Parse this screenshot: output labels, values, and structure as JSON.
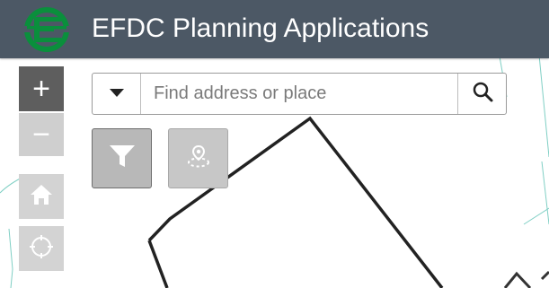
{
  "header": {
    "title": "EFDC Planning Applications",
    "logo_icon": "efdc-logo-icon",
    "background_color": "#4c5865",
    "logo_color": "#0a8f3c"
  },
  "map_controls": {
    "zoom_in_label": "+",
    "zoom_out_label": "−",
    "home_icon": "home-icon",
    "locate_icon": "locate-icon"
  },
  "search": {
    "placeholder": "Find address or place",
    "value": "",
    "dropdown_icon": "caret-down-icon",
    "submit_icon": "search-icon"
  },
  "tools": {
    "filter_icon": "filter-icon",
    "poi_icon": "location-pin-icon"
  }
}
